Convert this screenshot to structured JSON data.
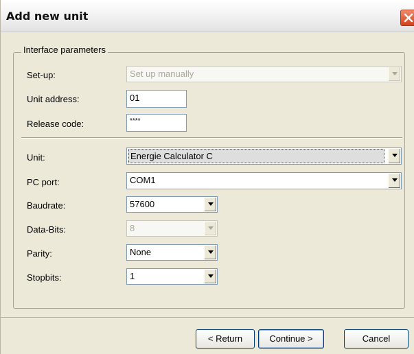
{
  "window": {
    "title": "Add new unit",
    "close_icon": "close-icon"
  },
  "group": {
    "label": "Interface parameters"
  },
  "fields": {
    "setup": {
      "label": "Set-up:",
      "value": "Set up manually",
      "enabled": false
    },
    "unit_address": {
      "label": "Unit address:",
      "value": "01"
    },
    "release_code": {
      "label": "Release code:",
      "value": "****"
    },
    "unit": {
      "label": "Unit:",
      "value": "Energie Calculator C"
    },
    "pc_port": {
      "label": "PC port:",
      "value": "COM1"
    },
    "baudrate": {
      "label": "Baudrate:",
      "value": "57600"
    },
    "data_bits": {
      "label": "Data-Bits:",
      "value": "8",
      "enabled": false
    },
    "parity": {
      "label": "Parity:",
      "value": "None"
    },
    "stopbits": {
      "label": "Stopbits:",
      "value": "1"
    }
  },
  "buttons": {
    "return": "< Return",
    "continue": "Continue >",
    "cancel": "Cancel"
  },
  "colors": {
    "dialog_bg": "#ece9d8",
    "field_border": "#7f9db9",
    "close_button": "#d1431c"
  }
}
